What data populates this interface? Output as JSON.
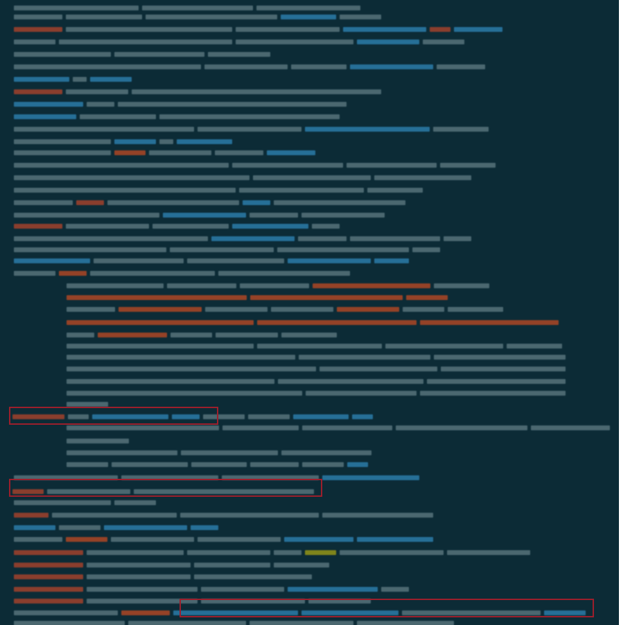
{
  "colors": {
    "background": "#0c2b36",
    "text": "#7f9aa1",
    "dim": "#5a767f",
    "accent_red": "#b4452b",
    "accent_orange": "#c24a22",
    "accent_blue": "#2f86b8",
    "accent_yellow": "#a6a313",
    "highlight_border": "#9c1f2c"
  },
  "terminal": {
    "title": ""
  },
  "highlights": [
    {
      "name": "received-from-ip-highlight"
    },
    {
      "name": "from-header-highlight"
    },
    {
      "name": "list-unsubscribe-highlight"
    }
  ]
}
